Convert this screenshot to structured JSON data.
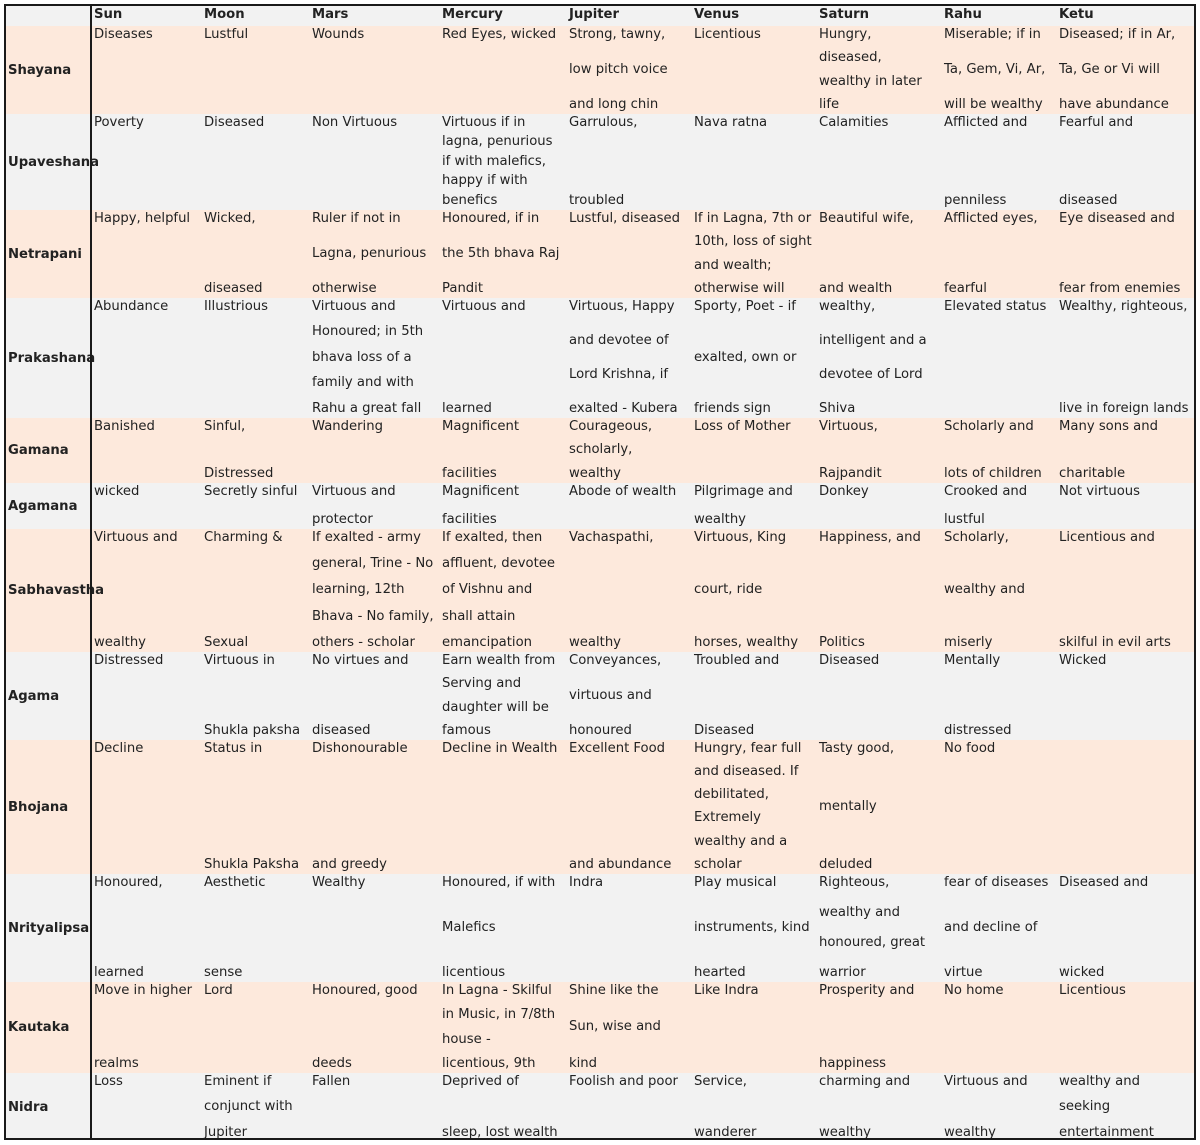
{
  "table": {
    "columns": [
      "",
      "Sun",
      "Moon",
      "Mars",
      "Mercury",
      "Jupiter",
      "Venus",
      "Saturn",
      "Rahu",
      "Ketu"
    ],
    "colors": {
      "peach_row": "#fde9dc",
      "grey_row": "#f2f2f2",
      "border": "#1a1a1a"
    },
    "rows": [
      {
        "label": "Shayana",
        "shade": "peach",
        "cells": [
          [
            "Diseases"
          ],
          [
            "Lustful"
          ],
          [
            "Wounds"
          ],
          [
            "Red Eyes, wicked"
          ],
          [
            "Strong, tawny,",
            "low pitch voice",
            "and long chin"
          ],
          [
            "Licentious"
          ],
          [
            "Hungry,",
            "diseased,",
            "wealthy in later",
            "life"
          ],
          [
            "Miserable; if in",
            "Ta, Gem, Vi, Ar,",
            "will be wealthy"
          ],
          [
            "Diseased; if in Ar,",
            "Ta, Ge or Vi will",
            "have abundance"
          ]
        ]
      },
      {
        "label": "Upaveshana",
        "shade": "grey",
        "cells": [
          [
            "Poverty"
          ],
          [
            "Diseased"
          ],
          [
            "Non Virtuous"
          ],
          [
            "Virtuous if in",
            "lagna, penurious",
            "if with malefics,",
            "happy if with",
            "benefics"
          ],
          [
            "Garrulous,",
            "",
            "",
            "troubled"
          ],
          [
            "Nava ratna"
          ],
          [
            "Calamities"
          ],
          [
            "Afflicted and",
            "",
            "",
            "penniless"
          ],
          [
            "Fearful and",
            "",
            "",
            "diseased"
          ]
        ]
      },
      {
        "label": "Netrapani",
        "shade": "peach",
        "cells": [
          [
            "Happy, helpful"
          ],
          [
            "Wicked,",
            "",
            "diseased"
          ],
          [
            "Ruler if not in",
            "Lagna, penurious",
            "otherwise"
          ],
          [
            "Honoured, if in",
            "the 5th bhava Raj",
            "Pandit"
          ],
          [
            "Lustful, diseased"
          ],
          [
            "If in Lagna, 7th or",
            "10th, loss of sight",
            "and wealth;",
            "otherwise will"
          ],
          [
            "Beautiful wife,",
            "",
            "and wealth"
          ],
          [
            "Afflicted eyes,",
            "",
            "fearful"
          ],
          [
            "Eye diseased and",
            "",
            "fear from enemies"
          ]
        ]
      },
      {
        "label": "Prakashana",
        "shade": "grey",
        "cells": [
          [
            "Abundance"
          ],
          [
            "Illustrious"
          ],
          [
            "Virtuous and",
            "Honoured; in 5th",
            "bhava loss of a",
            "family and with",
            "Rahu a great fall"
          ],
          [
            "Virtuous and",
            "",
            "",
            "",
            "learned"
          ],
          [
            "Virtuous, Happy",
            "and devotee of",
            "Lord Krishna, if",
            "exalted - Kubera"
          ],
          [
            "Sporty, Poet - if",
            "exalted, own or",
            "friends sign"
          ],
          [
            "wealthy,",
            "intelligent and a",
            "devotee of Lord",
            "Shiva"
          ],
          [
            "Elevated status"
          ],
          [
            "Wealthy, righteous,",
            "",
            "",
            "",
            "live in foreign lands"
          ]
        ]
      },
      {
        "label": "Gamana",
        "shade": "peach",
        "cells": [
          [
            "Banished"
          ],
          [
            "Sinful,",
            "",
            "Distressed"
          ],
          [
            "Wandering"
          ],
          [
            "Magnificent",
            "",
            "facilities"
          ],
          [
            "Courageous,",
            "scholarly,",
            "wealthy"
          ],
          [
            "Loss of Mother"
          ],
          [
            "Virtuous,",
            "",
            "Rajpandit"
          ],
          [
            "Scholarly and",
            "",
            "lots of children"
          ],
          [
            "Many sons and",
            "",
            "charitable"
          ]
        ]
      },
      {
        "label": "Agamana",
        "shade": "grey",
        "cells": [
          [
            "wicked"
          ],
          [
            "Secretly sinful"
          ],
          [
            "Virtuous and",
            "protector"
          ],
          [
            "Magnificent",
            "facilities"
          ],
          [
            "Abode of wealth"
          ],
          [
            "Pilgrimage and",
            "wealthy"
          ],
          [
            "Donkey"
          ],
          [
            "Crooked and",
            "lustful"
          ],
          [
            "Not virtuous"
          ]
        ]
      },
      {
        "label": "Sabhavastha",
        "shade": "peach",
        "cells": [
          [
            "Virtuous and",
            "",
            "",
            "",
            "wealthy"
          ],
          [
            "Charming &",
            "",
            "",
            "",
            "Sexual"
          ],
          [
            "If exalted - army",
            "general, Trine - No",
            "learning, 12th",
            "Bhava - No family,",
            "others - scholar"
          ],
          [
            "If exalted, then",
            "affluent, devotee",
            "of Vishnu and",
            "shall attain",
            "emancipation"
          ],
          [
            "Vachaspathi,",
            "",
            "",
            "",
            "wealthy"
          ],
          [
            "Virtuous, King",
            "",
            "court, ride",
            "",
            "horses, wealthy"
          ],
          [
            "Happiness, and",
            "",
            "",
            "",
            "Politics"
          ],
          [
            "Scholarly,",
            "",
            "wealthy and",
            "",
            "miserly"
          ],
          [
            "Licentious and",
            "",
            "",
            "",
            "skilful in evil arts"
          ]
        ]
      },
      {
        "label": "Agama",
        "shade": "grey",
        "cells": [
          [
            "Distressed"
          ],
          [
            "Virtuous in",
            "",
            "",
            "Shukla paksha"
          ],
          [
            "No virtues and",
            "",
            "",
            "diseased"
          ],
          [
            "Earn wealth from",
            "Serving and",
            "daughter will be",
            "famous"
          ],
          [
            "Conveyances,",
            "virtuous and",
            "honoured"
          ],
          [
            "Troubled and",
            "",
            "Diseased"
          ],
          [
            "Diseased"
          ],
          [
            "Mentally",
            "",
            "distressed"
          ],
          [
            "Wicked"
          ]
        ]
      },
      {
        "label": "Bhojana",
        "shade": "peach",
        "cells": [
          [
            "Decline"
          ],
          [
            "Status in",
            "",
            "",
            "",
            "",
            "Shukla Paksha"
          ],
          [
            "Dishonourable",
            "",
            "",
            "",
            "",
            "and greedy"
          ],
          [
            "Decline in Wealth"
          ],
          [
            "Excellent Food",
            "",
            "",
            "",
            "",
            "and abundance"
          ],
          [
            "Hungry, fear full",
            "and diseased. If",
            "debilitated,",
            "Extremely",
            "wealthy and a",
            "scholar"
          ],
          [
            "Tasty good,",
            "",
            "mentally",
            "",
            "deluded"
          ],
          [
            "No food"
          ],
          [
            ""
          ]
        ]
      },
      {
        "label": "Nrityalipsa",
        "shade": "grey",
        "cells": [
          [
            "Honoured,",
            "",
            "",
            "learned"
          ],
          [
            "Aesthetic",
            "",
            "",
            "sense"
          ],
          [
            "Wealthy"
          ],
          [
            "Honoured, if with",
            "",
            "Malefics",
            "",
            "licentious"
          ],
          [
            "Indra"
          ],
          [
            "Play musical",
            "",
            "instruments, kind",
            "",
            "hearted"
          ],
          [
            "Righteous,",
            "wealthy and",
            "honoured, great",
            "warrior"
          ],
          [
            "fear of diseases",
            "",
            "and decline of",
            "",
            "virtue"
          ],
          [
            "Diseased and",
            "",
            "",
            "wicked"
          ]
        ]
      },
      {
        "label": "Kautaka",
        "shade": "peach",
        "cells": [
          [
            "Move in higher",
            "",
            "",
            "realms"
          ],
          [
            "Lord"
          ],
          [
            "Honoured, good",
            "",
            "",
            "deeds"
          ],
          [
            "In Lagna - Skilful",
            "in Music, in 7/8th",
            "house -",
            "licentious, 9th"
          ],
          [
            "Shine like the",
            "Sun, wise and",
            "kind"
          ],
          [
            "Like Indra"
          ],
          [
            "Prosperity and",
            "",
            "",
            "happiness"
          ],
          [
            "No home"
          ],
          [
            "Licentious"
          ]
        ]
      },
      {
        "label": "Nidra",
        "shade": "grey",
        "cells": [
          [
            "Loss"
          ],
          [
            "Eminent if",
            "conjunct with",
            "Jupiter"
          ],
          [
            "Fallen"
          ],
          [
            "Deprived of",
            "",
            "sleep, lost wealth"
          ],
          [
            "Foolish and poor"
          ],
          [
            "Service,",
            "",
            "wanderer"
          ],
          [
            "charming and",
            "",
            "wealthy"
          ],
          [
            "Virtuous and",
            "",
            "wealthy"
          ],
          [
            "wealthy and",
            "seeking",
            "entertainment"
          ]
        ]
      }
    ]
  }
}
